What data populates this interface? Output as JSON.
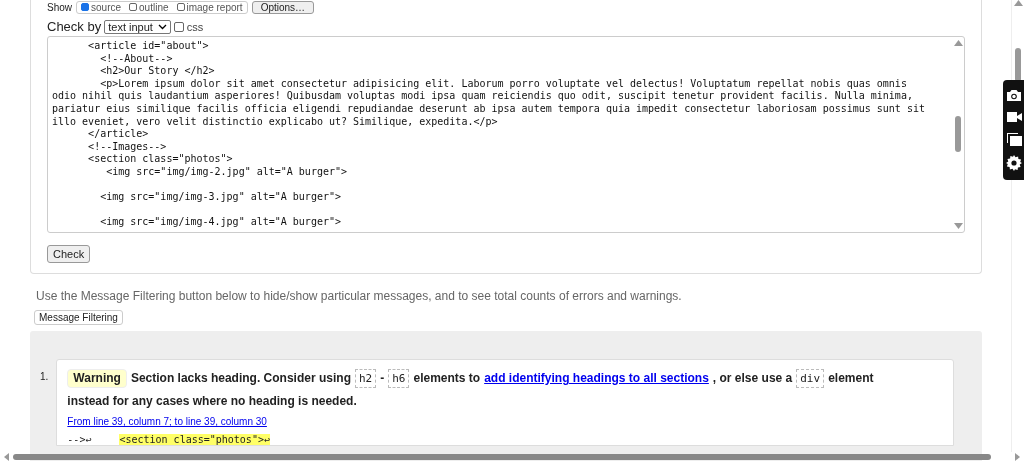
{
  "show_row": {
    "label": "Show",
    "options": [
      {
        "label": "source",
        "checked": true
      },
      {
        "label": "outline",
        "checked": false
      },
      {
        "label": "image report",
        "checked": false
      }
    ],
    "options_button": "Options…"
  },
  "check_by": {
    "label": "Check by",
    "select": "text input",
    "css": {
      "label": "css",
      "checked": false
    }
  },
  "source_blocks": [
    [
      "      <article id=\"about\">",
      "        <!--About-->",
      "        <h2>Our Story </h2>",
      "        <p>Lorem ipsum dolor sit amet consectetur adipisicing elit. Laborum porro voluptate vel delectus! Voluptatum repellat nobis quas omnis",
      "odio nihil quis laudantium asperiores! Quibusdam voluptas modi ipsa quam reiciendis quo odit, suscipit tenetur provident facilis. Nulla minima,",
      "pariatur eius similique facilis officia eligendi repudiandae deserunt ab ipsa autem tempora quia impedit consectetur laboriosam possimus sunt sit",
      "illo eveniet, vero velit distinctio explicabo ut? Similique, expedita.</p>",
      "      </article>",
      "      <!--Images-->",
      "      <section class=\"photos\">",
      "         <img src=\"img/img-2.jpg\" alt=\"A burger\">"
    ],
    [
      "        <img src=\"img/img-3.jpg\" alt=\"A burger\">"
    ],
    [
      "        <img src=\"img/img-4.jpg\" alt=\"A burger\">"
    ]
  ],
  "check_button": "Check",
  "filter_note": "Use the Message Filtering button below to hide/show particular messages, and to see total counts of errors and warnings.",
  "filter_button": "Message Filtering",
  "messages": [
    {
      "number": "1.",
      "kind": "warning",
      "badge": "Warning",
      "parts": [
        {
          "kind": "text",
          "text": "Section lacks heading. Consider using"
        },
        {
          "kind": "code",
          "text": "h2"
        },
        {
          "kind": "text",
          "text": "-"
        },
        {
          "kind": "code",
          "text": "h6"
        },
        {
          "kind": "text",
          "text": "elements to"
        },
        {
          "kind": "link",
          "text": "add identifying headings to all sections"
        },
        {
          "kind": "text",
          "text": ", or else use a"
        },
        {
          "kind": "code",
          "text": "div"
        },
        {
          "kind": "text",
          "text": "element"
        },
        {
          "kind": "text",
          "text": "instead for any cases where no heading is needed."
        }
      ],
      "location": "From line 39, column 7; to line 39, column 30",
      "extract": {
        "before": "-->↩",
        "highlight": "<section class=\"photos\">↩"
      }
    }
  ]
}
